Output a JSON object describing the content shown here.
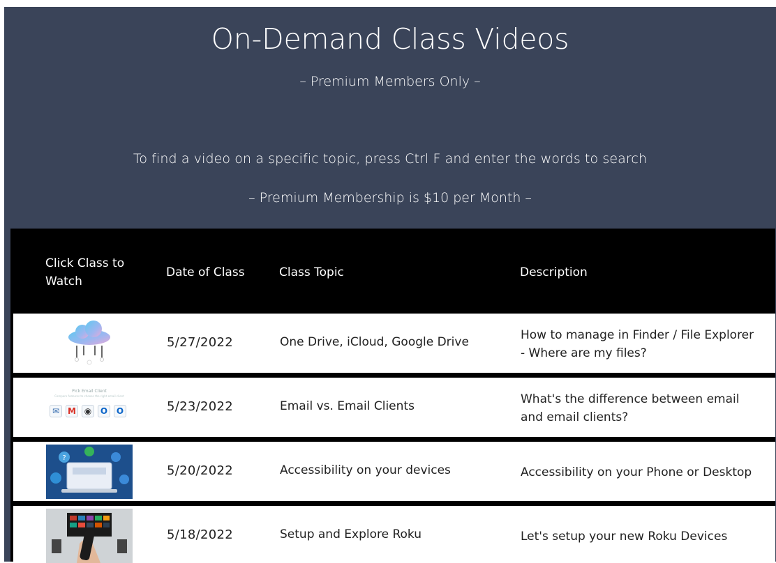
{
  "header": {
    "title": "On-Demand Class Videos",
    "subtitle": "– Premium Members Only –",
    "search_hint": "To find a video on a specific topic, press Ctrl F and enter the words to search",
    "membership": "– Premium Membership is $10 per Month –"
  },
  "table": {
    "columns": {
      "watch": "Click Class to Watch",
      "date": "Date of Class",
      "topic": "Class Topic",
      "description": "Description"
    },
    "rows": [
      {
        "thumb_icon": "cloud-icon",
        "date": "5/27/2022",
        "topic": "One Drive, iCloud, Google Drive",
        "description": "How to manage in Finder / File Explorer - Where are my files?"
      },
      {
        "thumb_icon": "email-clients-icon",
        "thumb_caption": "Pick Email Client",
        "thumb_subcaption": "Compare features to choose the right email client",
        "date": "5/23/2022",
        "topic": "Email vs. Email Clients",
        "description": "What's the difference between email and email clients?"
      },
      {
        "thumb_icon": "accessibility-icon",
        "date": "5/20/2022",
        "topic": "Accessibility on your devices",
        "description": "Accessibility on your Phone or Desktop"
      },
      {
        "thumb_icon": "roku-remote-icon",
        "date": "5/18/2022",
        "topic": "Setup and Explore Roku",
        "description": "Let's setup your new Roku Devices"
      }
    ]
  },
  "colors": {
    "header_bg": "#3a4459",
    "table_header_bg": "#000000",
    "row_bg": "#ffffff",
    "text_dark": "#222222"
  }
}
